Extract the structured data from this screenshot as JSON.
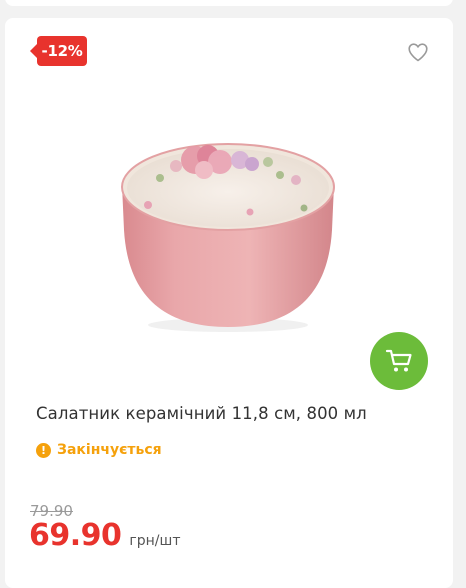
{
  "product": {
    "discount_label": "-12%",
    "title": "Салатник керамічний 11,8 см, 800 мл",
    "status": "Закінчується",
    "old_price": "79.90",
    "price": "69.90",
    "unit": "грн/шт"
  },
  "icons": {
    "favorite": "heart-outline-icon",
    "cart": "shopping-cart-icon",
    "status": "warning-icon"
  },
  "colors": {
    "discount": "#e8332d",
    "price": "#e8332d",
    "cart_button": "#6cbc3a",
    "status": "#f5a10c"
  }
}
